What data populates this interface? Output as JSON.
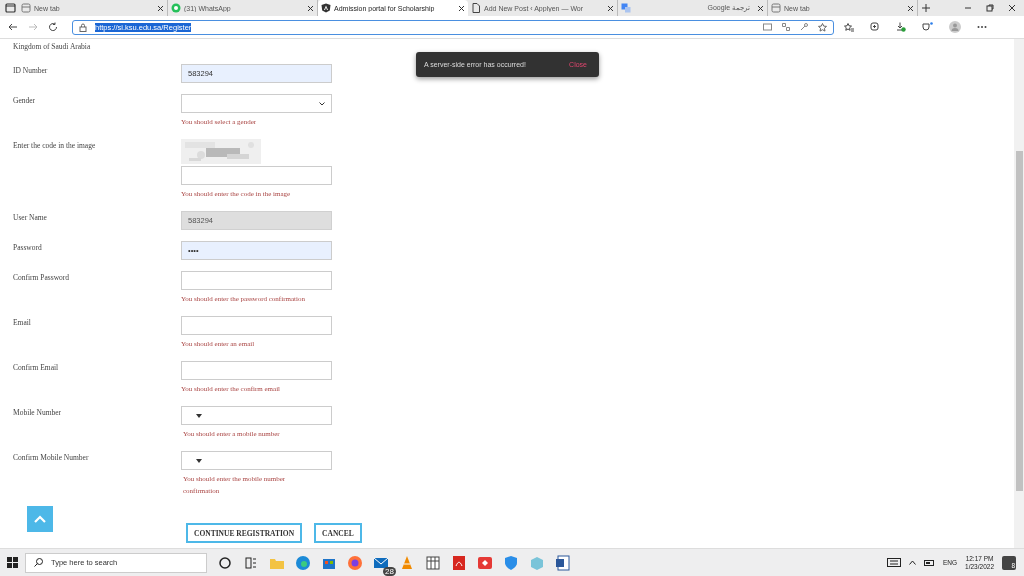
{
  "browser": {
    "tabs": [
      {
        "kind": "newtab",
        "title": "New tab",
        "selected": false
      },
      {
        "kind": "whatsapp",
        "title": "(31) WhatsApp",
        "selected": false
      },
      {
        "kind": "angular",
        "title": "Admission portal for Scholarship",
        "selected": true
      },
      {
        "kind": "page",
        "title": "Add New Post ‹ Applyen — Wor",
        "selected": false
      },
      {
        "kind": "translate",
        "title": "Google ترجمة",
        "selected": false
      },
      {
        "kind": "newtab",
        "title": "New tab",
        "selected": false
      }
    ],
    "url": "https://si.ksu.edu.sa/Register",
    "url_selected": true
  },
  "form": {
    "heading": "Kingdom of Saudi Arabia",
    "fields": [
      {
        "kind": "text",
        "label": "ID Number",
        "value": "583294",
        "autofilled": true,
        "disabled": false
      },
      {
        "kind": "select",
        "label": "Gender",
        "error": "You should select a gender"
      },
      {
        "kind": "captcha",
        "label": "Enter the code in the image",
        "error": "You should enter the code in the image"
      },
      {
        "kind": "text",
        "label": "User Name",
        "value": "583294",
        "autofilled": false,
        "disabled": true
      },
      {
        "kind": "text",
        "label": "Password",
        "value": "••••",
        "autofilled": true,
        "disabled": false
      },
      {
        "kind": "text",
        "label": "Confirm Password",
        "error": "You should enter the password confirmation",
        "autofilled": false,
        "disabled": false
      },
      {
        "kind": "text",
        "label": "Email",
        "error": "You should enter an email",
        "autofilled": false,
        "disabled": false
      },
      {
        "kind": "text",
        "label": "Confirm Email",
        "error": "You should enter the confirm email",
        "autofilled": false,
        "disabled": false
      },
      {
        "kind": "phone",
        "label": "Mobile Number",
        "error": "You should enter a mobile number"
      },
      {
        "kind": "phone",
        "label": "Confirm Mobile Number",
        "error": "You should enter the mobile number confirmation"
      }
    ],
    "buttons": [
      "CONTINUE REGISTRATION",
      "CANCEL"
    ]
  },
  "toast": {
    "message": "A server-side error has occurred!",
    "action": "Close"
  },
  "taskbar": {
    "search_placeholder": "Type here to search",
    "mail_badge": "28",
    "language": "ENG",
    "time": "12:17 PM",
    "date": "1/23/2022",
    "notifications": "8"
  }
}
